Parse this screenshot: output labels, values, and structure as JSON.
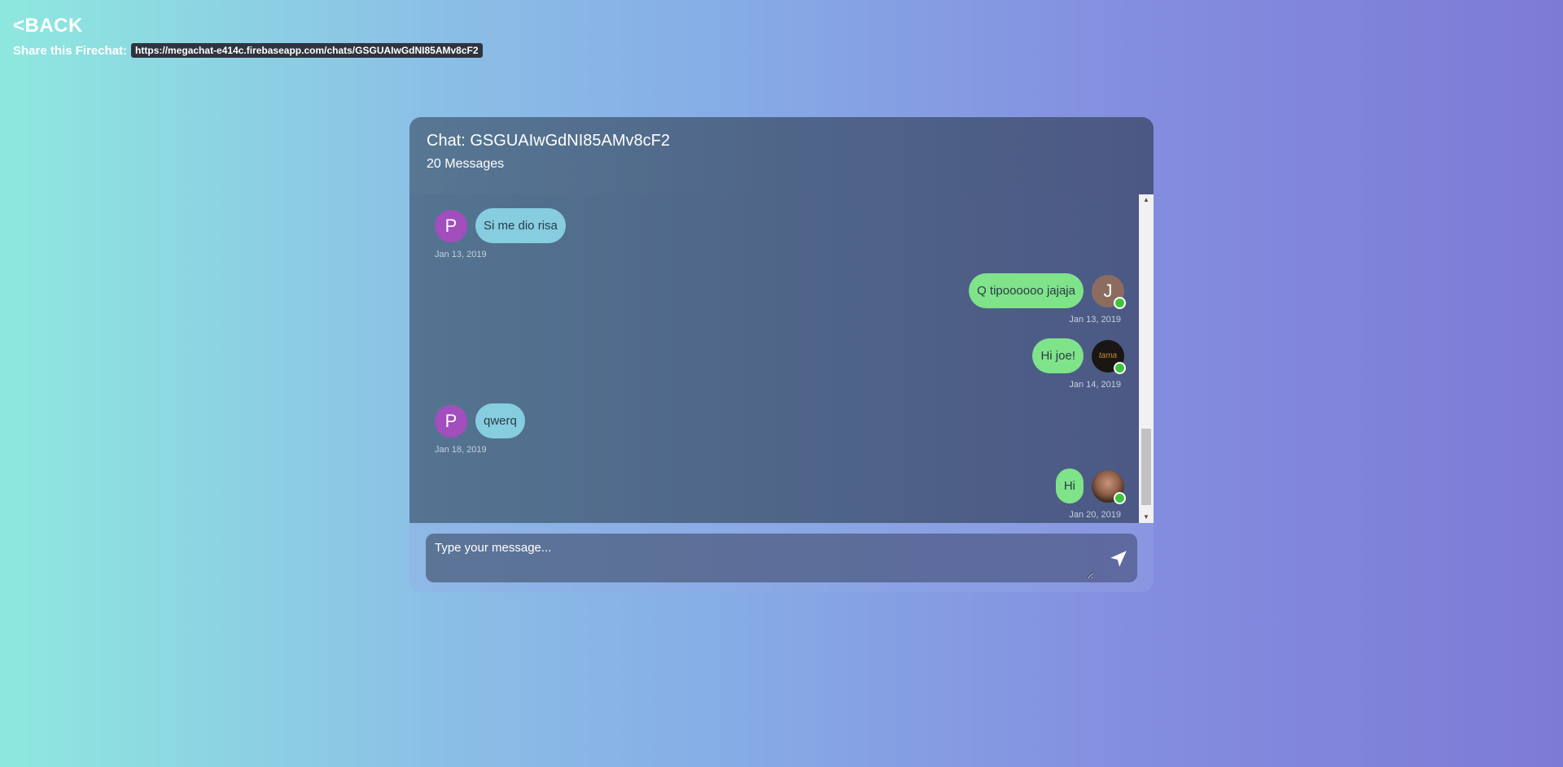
{
  "nav": {
    "back_label": "<BACK"
  },
  "share": {
    "label": "Share this Firechat:",
    "url": "https://megachat-e414c.firebaseapp.com/chats/GSGUAIwGdNI85AMv8cF2"
  },
  "chat": {
    "title": "Chat: GSGUAIwGdNI85AMv8cF2",
    "message_count": "20 Messages",
    "messages": [
      {
        "side": "left",
        "avatar_letter": "P",
        "text": "Si me dio risa",
        "date": "Jan 13, 2019",
        "online": false
      },
      {
        "side": "right",
        "avatar_letter": "J",
        "text": "Q tipoooooo jajaja",
        "date": "Jan 13, 2019",
        "online": true
      },
      {
        "side": "right",
        "avatar_letter": "tama",
        "text": "Hi joe!",
        "date": "Jan 14, 2019",
        "online": true
      },
      {
        "side": "left",
        "avatar_letter": "P",
        "text": "qwerq",
        "date": "Jan 18, 2019",
        "online": false
      },
      {
        "side": "right",
        "avatar_letter": "",
        "text": "Hi",
        "date": "Jan 20, 2019",
        "online": true
      }
    ]
  },
  "composer": {
    "placeholder": "Type your message..."
  },
  "icons": {
    "send": "send-icon",
    "scroll_up": "arrow-up-icon",
    "scroll_down": "arrow-down-icon"
  },
  "colors": {
    "left_bubble": "#86cde0",
    "right_bubble": "#7fe38a",
    "online_dot": "#3fc33f",
    "avatar_p": "#a24ebc",
    "avatar_j": "#8d6c60"
  },
  "scroll": {
    "position_fraction": 0.93
  }
}
